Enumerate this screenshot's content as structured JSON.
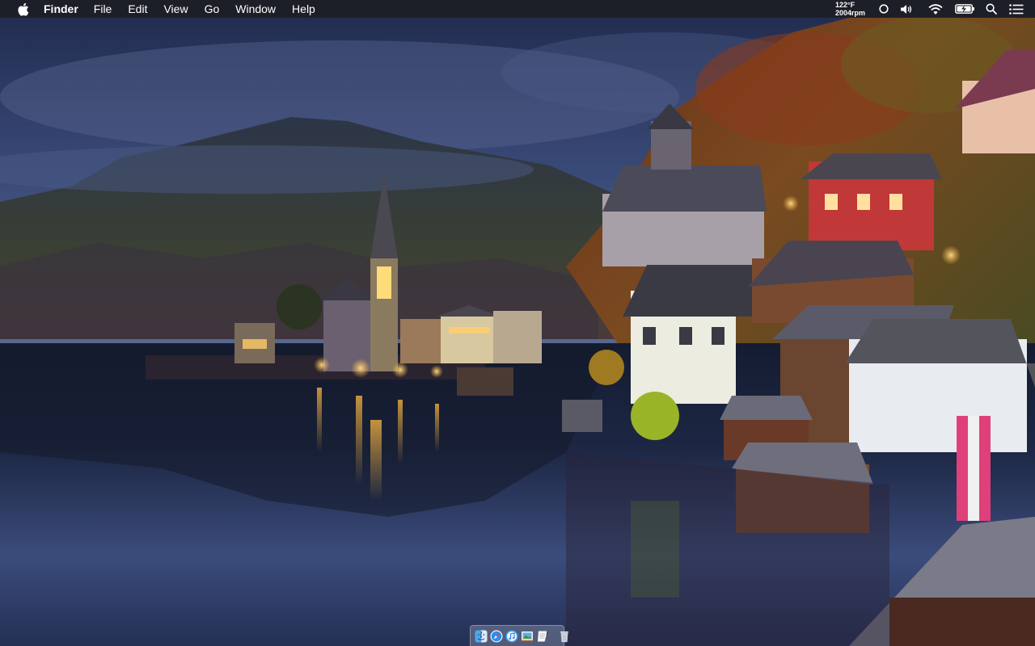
{
  "menubar": {
    "apple_icon": "apple-logo-icon",
    "app_name": "Finder",
    "menus": [
      "File",
      "Edit",
      "View",
      "Go",
      "Window",
      "Help"
    ],
    "status": {
      "temperature": "122°F",
      "fan_speed": "2004rpm"
    },
    "icons": [
      "circle-icon",
      "volume-icon",
      "wifi-icon",
      "battery-charging-icon",
      "spotlight-search-icon",
      "notification-center-icon"
    ]
  },
  "dock": {
    "apps": [
      "finder-icon",
      "safari-icon",
      "itunes-icon",
      "preview-icon",
      "textedit-icon"
    ],
    "trash": "trash-icon"
  },
  "colors": {
    "menubar_bg": "#1c1e24",
    "menubar_text": "#ffffff"
  }
}
